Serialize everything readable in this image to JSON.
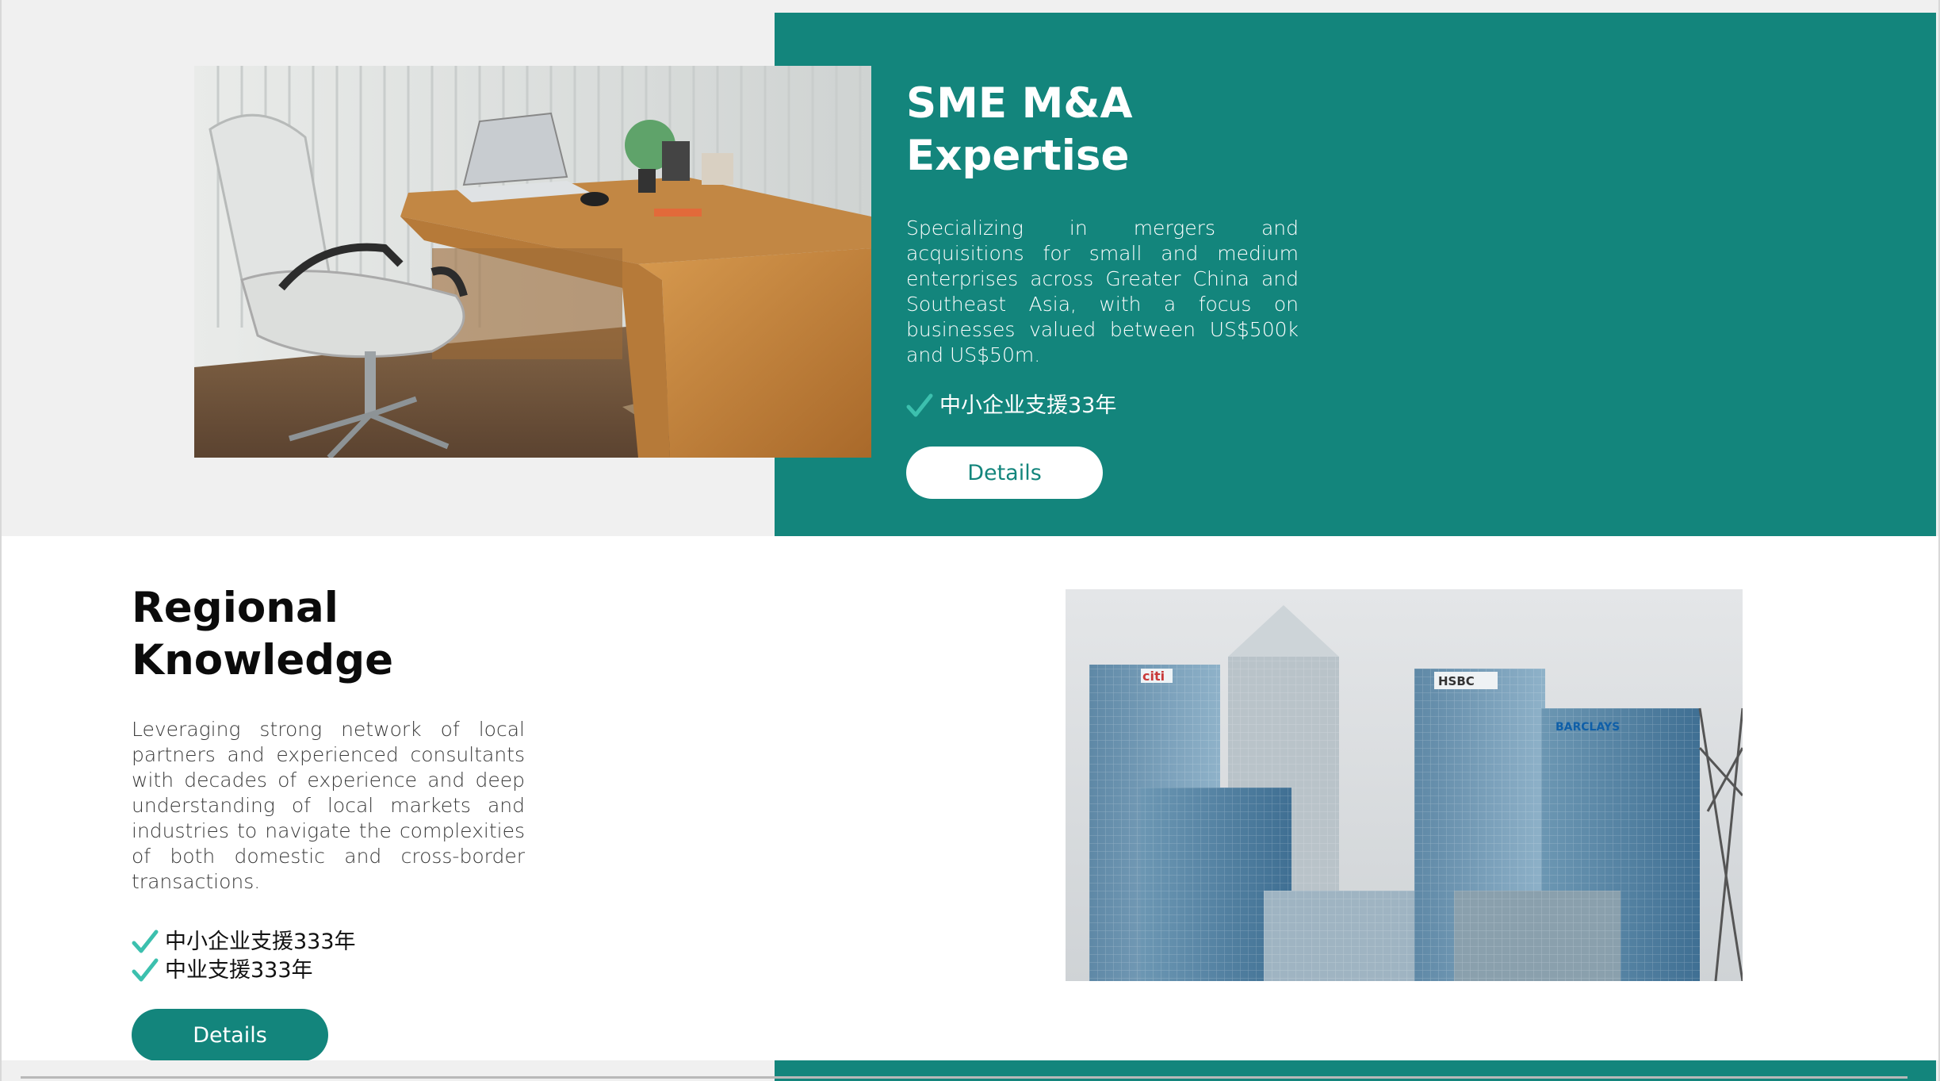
{
  "brand": {
    "accent": "#13857c",
    "check_color": "#3cc0ae"
  },
  "section1": {
    "title_line1": "SME M&A",
    "title_line2": "Expertise",
    "description": "Specializing in mergers and acquisitions for small and medium enterprises across Greater China and Southeast Asia, with a focus on businesses valued between US$500k and US$50m.",
    "checks": [
      "中小企业支援33年"
    ],
    "button_label": "Details",
    "image": "office-desk-photo"
  },
  "section2": {
    "title_line1": "Regional",
    "title_line2": "Knowledge",
    "description": "Leveraging strong network of local partners and experienced consultants with decades of experience and deep understanding of local markets and industries to navigate the complexities of both domestic and cross-border transactions.",
    "checks": [
      "中小企业支援333年",
      "中业支援333年"
    ],
    "button_label": "Details",
    "image": "skyscrapers-photo",
    "building_signs": [
      "citi",
      "HSBC",
      "BARCLAYS"
    ]
  }
}
